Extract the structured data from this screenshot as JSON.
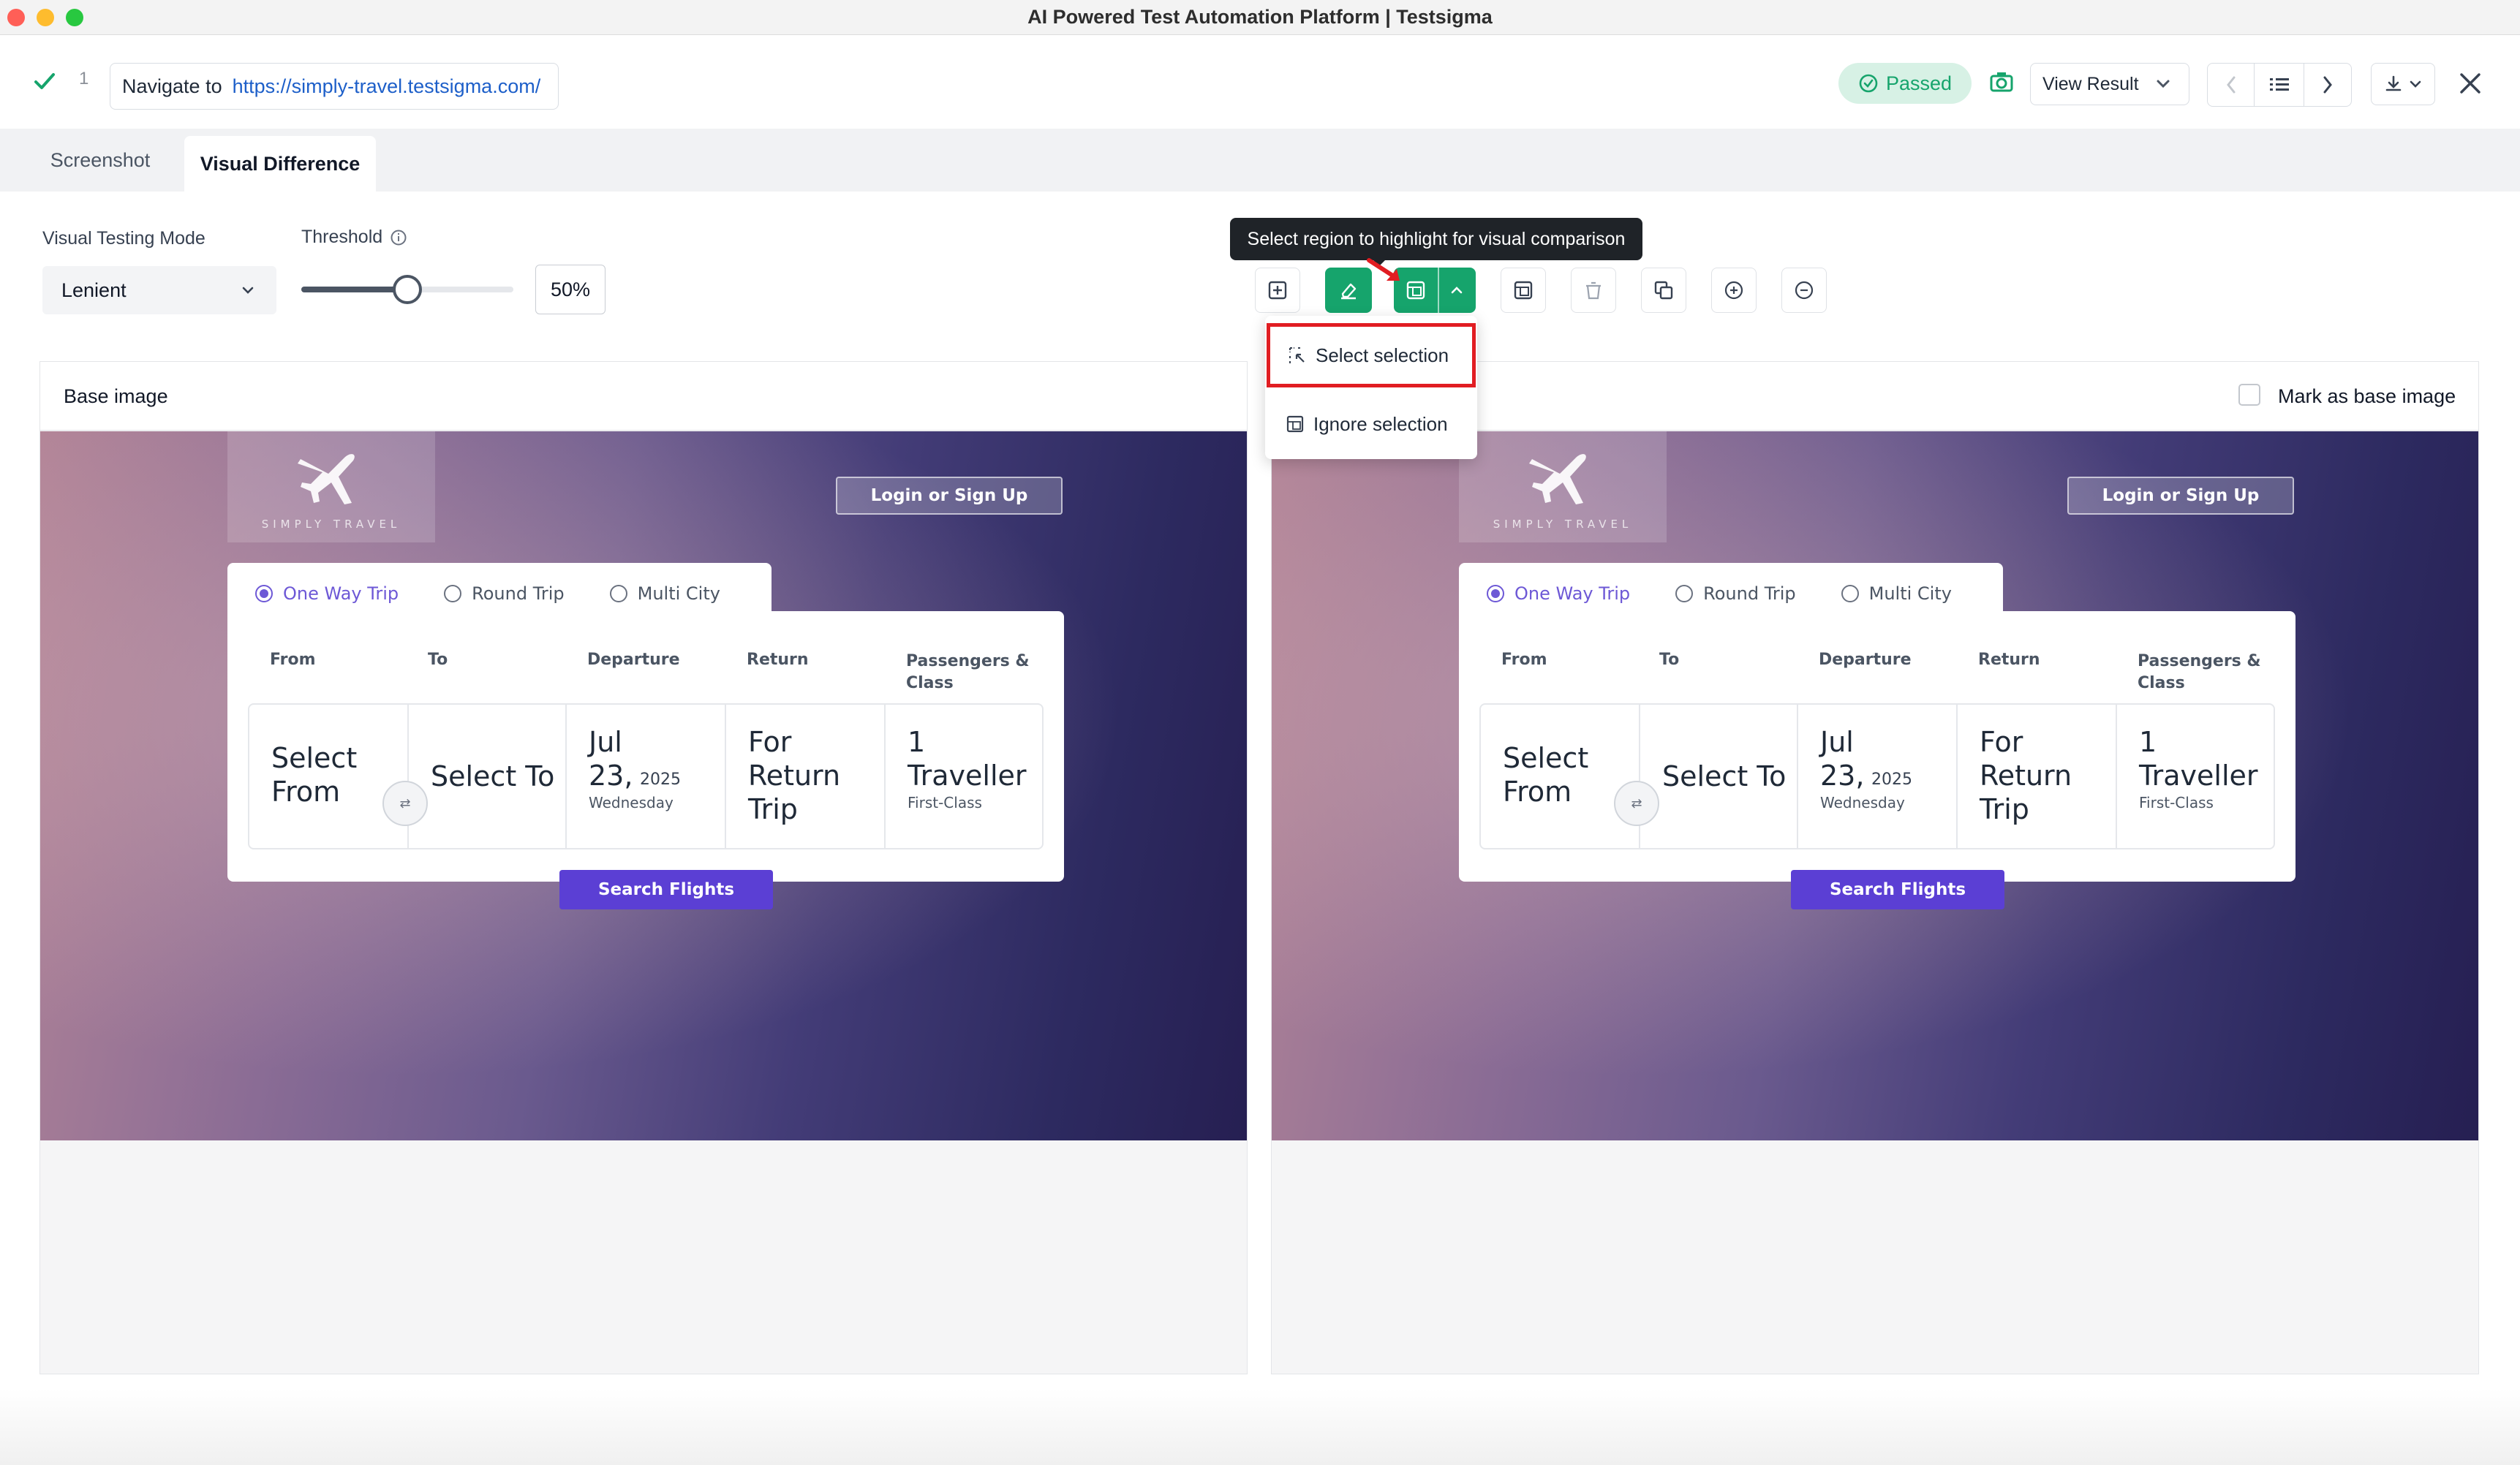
{
  "window": {
    "title": "AI Powered Test Automation Platform | Testsigma"
  },
  "step": {
    "number": "1",
    "action_label": "Navigate to",
    "url": "https://simply-travel.testsigma.com/",
    "status": "Passed",
    "view_result_label": "View Result",
    "status_color": "#16a46c"
  },
  "tabs": [
    {
      "label": "Screenshot",
      "active": false
    },
    {
      "label": "Visual Difference",
      "active": true
    }
  ],
  "controls": {
    "mode_label": "Visual Testing Mode",
    "mode_value": "Lenient",
    "threshold_label": "Threshold",
    "threshold_value": "50%",
    "threshold_fraction": 0.5
  },
  "toolbar": {
    "tooltip": "Select region to highlight for visual comparison",
    "dropdown": [
      {
        "label": "Select selection",
        "icon": "select-region-icon"
      },
      {
        "label": "Ignore selection",
        "icon": "ignore-region-icon"
      }
    ]
  },
  "panels": {
    "base_title": "Base image",
    "mark_base_label": "Mark as base image"
  },
  "site": {
    "brand": "SIMPLY TRAVEL",
    "login": "Login or Sign Up",
    "trip_types": [
      "One Way Trip",
      "Round Trip",
      "Multi City"
    ],
    "headers": [
      "From",
      "To",
      "Departure",
      "Return",
      "Passengers & Class"
    ],
    "from_value": "Select From",
    "to_value": "Select To",
    "departure_value": "Jul 23,",
    "departure_year": "2025",
    "departure_day": "Wednesday",
    "return_value": "For Return Trip",
    "passengers_value": "1 Traveller",
    "class_value": "First-Class",
    "search_button": "Search Flights"
  }
}
